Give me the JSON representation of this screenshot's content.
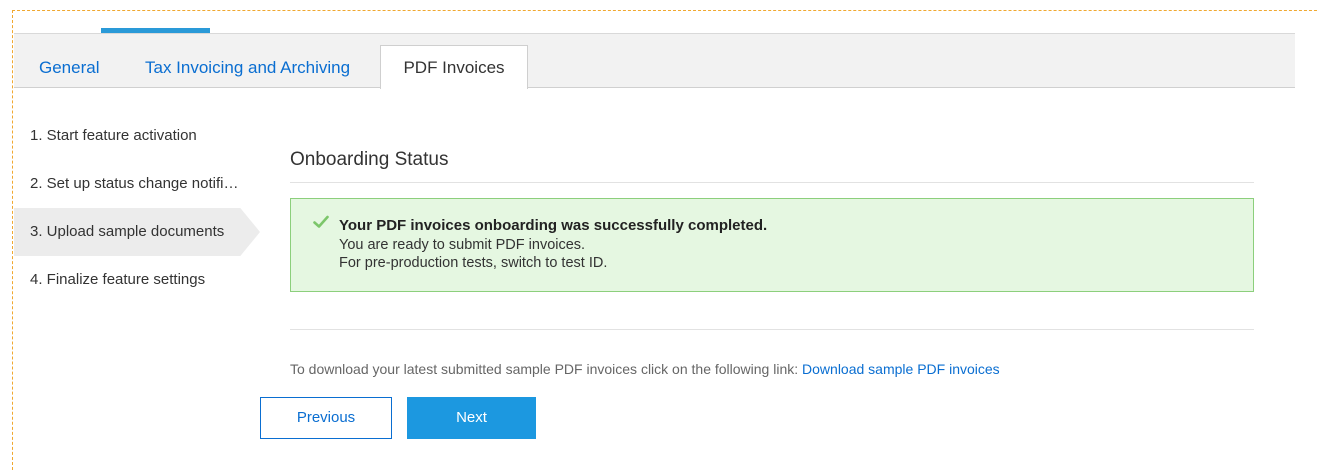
{
  "tabs": {
    "general": "General",
    "tax": "Tax Invoicing and Archiving",
    "pdf": "PDF Invoices"
  },
  "steps": [
    "1. Start feature activation",
    "2. Set up status change notifi…",
    "3. Upload sample documents",
    "4. Finalize feature settings"
  ],
  "main": {
    "heading": "Onboarding Status",
    "success": {
      "icon": "check-icon",
      "title": "Your PDF invoices onboarding was successfully completed.",
      "line1": "You are ready to submit PDF invoices.",
      "line2": "For pre-production tests, switch to test ID."
    },
    "download_prefix": "To download your latest submitted sample PDF invoices click on the following link: ",
    "download_link": "Download sample PDF invoices"
  },
  "buttons": {
    "previous": "Previous",
    "next": "Next"
  },
  "colors": {
    "accent": "#0a6ed1",
    "success_bg": "#e5f7e1",
    "success_border": "#8ccf7c",
    "check": "#7cc66a",
    "next_button": "#1c98e0"
  }
}
